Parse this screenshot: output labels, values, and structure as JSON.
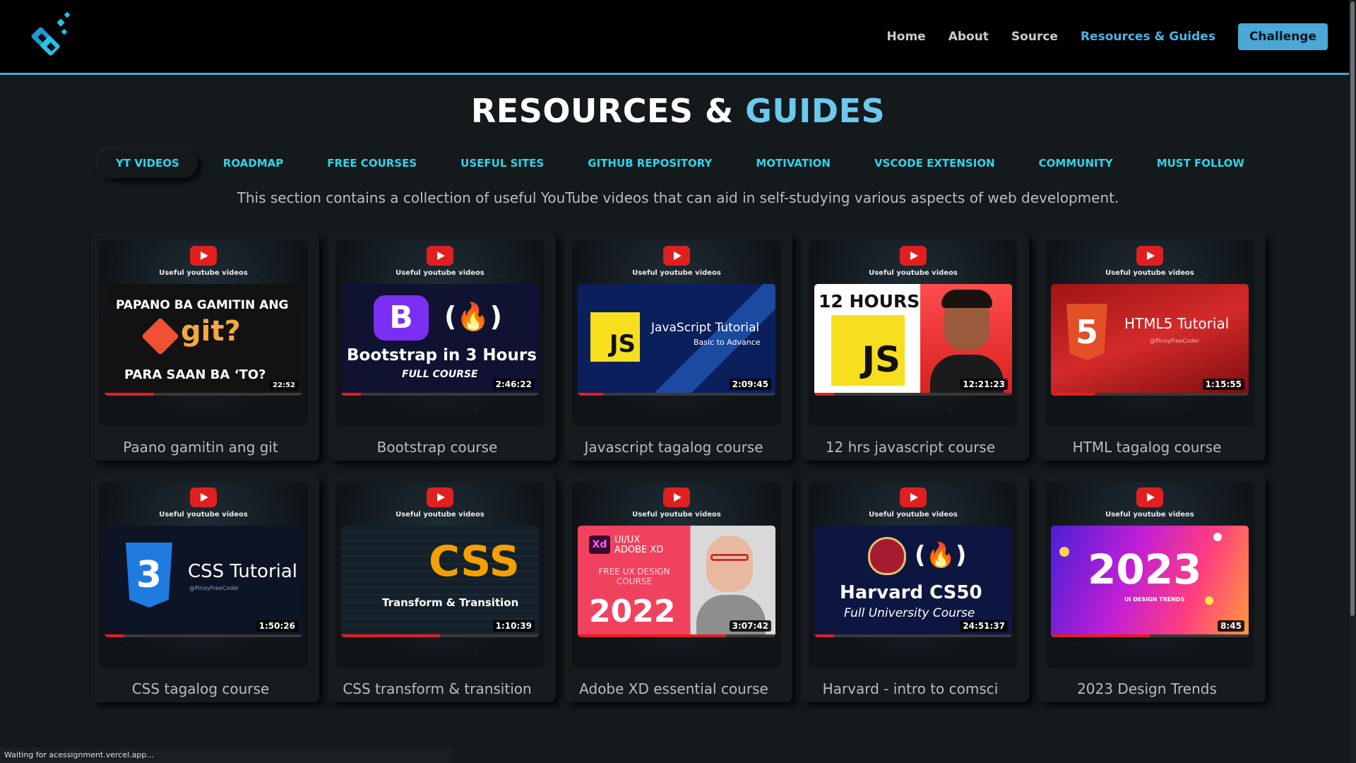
{
  "nav": {
    "home": "Home",
    "about": "About",
    "source": "Source",
    "resources": "Resources & Guides",
    "challenge": "Challenge"
  },
  "page": {
    "title_main": "RESOURCES & ",
    "title_accent": "GUIDES",
    "description": "This section contains a collection of useful YouTube videos that can aid in self-studying various aspects of web development."
  },
  "tabs": [
    {
      "label": "YT VIDEOS",
      "selected": true
    },
    {
      "label": "ROADMAP"
    },
    {
      "label": "FREE COURSES"
    },
    {
      "label": "USEFUL SITES"
    },
    {
      "label": "GITHUB REPOSITORY"
    },
    {
      "label": "MOTIVATION"
    },
    {
      "label": "VSCODE EXTENSION"
    },
    {
      "label": "COMMUNITY"
    },
    {
      "label": "MUST FOLLOW"
    }
  ],
  "cards": [
    {
      "title": "Paano gamitin ang git",
      "caption": "Useful youtube videos",
      "duration": "22:52",
      "thumb_text": [
        "PAPANO BA GAMITIN ANG",
        "git?",
        "PARA SAAN BA ‘TO?"
      ],
      "progress": 0.25
    },
    {
      "title": "Bootstrap course",
      "caption": "Useful youtube videos",
      "duration": "2:46:22",
      "thumb_text": [
        "B",
        "(🔥)",
        "Bootstrap in 3 Hours",
        "FULL COURSE"
      ],
      "progress": 0.1
    },
    {
      "title": "Javascript tagalog course",
      "caption": "Useful youtube videos",
      "duration": "2:09:45",
      "thumb_text": [
        "JS",
        "JavaScript Tutorial",
        "Basic to Advance"
      ],
      "progress": 0.13
    },
    {
      "title": "12 hrs javascript course",
      "caption": "Useful youtube videos",
      "duration": "12:21:23",
      "thumb_text": [
        "12 HOURS",
        "JS"
      ],
      "progress": 0.1
    },
    {
      "title": "HTML tagalog course",
      "caption": "Useful youtube videos",
      "duration": "1:15:55",
      "thumb_text": [
        "5",
        "HTML5 Tutorial",
        "@PinoyFreeCoder"
      ],
      "progress": 0.22
    },
    {
      "title": "CSS tagalog course",
      "caption": "Useful youtube videos",
      "duration": "1:50:26",
      "thumb_text": [
        "3",
        "CSS Tutorial",
        "@PinoyFreeCoder"
      ],
      "progress": 0.1
    },
    {
      "title": "CSS transform & transition",
      "caption": "Useful youtube videos",
      "duration": "1:10:39",
      "thumb_text": [
        "CSS",
        "Transform & Transition"
      ],
      "progress": 0.5
    },
    {
      "title": "Adobe XD essential course",
      "caption": "Useful youtube videos",
      "duration": "3:07:42",
      "thumb_text": [
        "Xd",
        "UI/UX ADOBE XD",
        "FREE UX DESIGN COURSE",
        "2022"
      ],
      "progress": 0.75
    },
    {
      "title": "Harvard - intro to comsci",
      "caption": "Useful youtube videos",
      "duration": "24:51:37",
      "thumb_text": [
        "(🔥)",
        "Harvard CS50",
        "Full University Course"
      ],
      "progress": 0.1
    },
    {
      "title": "2023 Design Trends",
      "caption": "Useful youtube videos",
      "duration": "8:45",
      "thumb_text": [
        "2023",
        "UI DESIGN TRENDS"
      ],
      "progress": 0.5
    }
  ],
  "status": {
    "text": "Waiting for acessignment.vercel.app..."
  },
  "colors": {
    "accent": "#4aa7d6",
    "tab_text": "#2fd4e8",
    "youtube_red": "#e02020"
  },
  "icons": {
    "logo": "site-logo",
    "youtube": "youtube-play-icon"
  }
}
